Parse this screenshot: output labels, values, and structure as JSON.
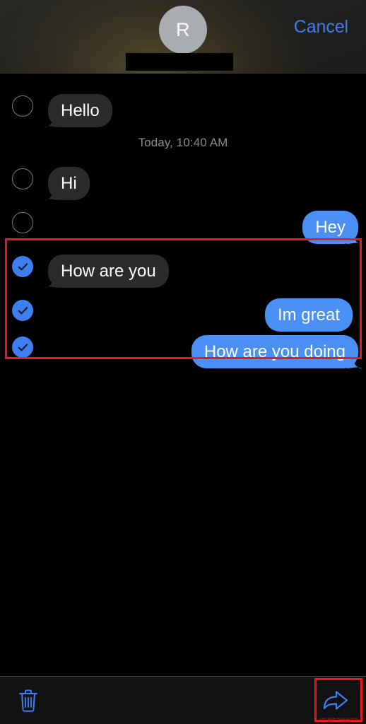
{
  "header": {
    "avatar_letter": "R",
    "avatar_name": "avatar",
    "redacted_name_bar": "",
    "cancel_label": "Cancel",
    "accent_color": "#3d7ef0",
    "avatar_color": "#a9adb1"
  },
  "thread": {
    "timestamp": "Today, 10:40 AM",
    "timestamp_color": "#8b8b90",
    "incoming_bubble_color": "#2b2b2d",
    "outgoing_bubble_color": "#4a90f5",
    "messages": [
      {
        "text": "Hello",
        "direction": "incoming",
        "selected": false,
        "tail": true
      },
      {
        "text": "Hi",
        "direction": "incoming",
        "selected": false,
        "tail": true
      },
      {
        "text": "Hey",
        "direction": "outgoing",
        "selected": false,
        "tail": true
      },
      {
        "text": "How are you",
        "direction": "incoming",
        "selected": true,
        "tail": true
      },
      {
        "text": "Im great",
        "direction": "outgoing",
        "selected": true,
        "tail": false
      },
      {
        "text": "How are you doing",
        "direction": "outgoing",
        "selected": true,
        "tail": true
      }
    ]
  },
  "annotation": {
    "selection_highlight_color": "#e51b20",
    "forward_highlight_color": "#e51b20",
    "watermark_text": "TECHMESSENGER"
  },
  "toolbar": {
    "delete_label": "Delete",
    "delete_icon": "trash-icon",
    "forward_label": "Forward",
    "forward_icon": "forward-arrow-icon",
    "icon_color": "#3d7ef0",
    "background": "#121212"
  }
}
